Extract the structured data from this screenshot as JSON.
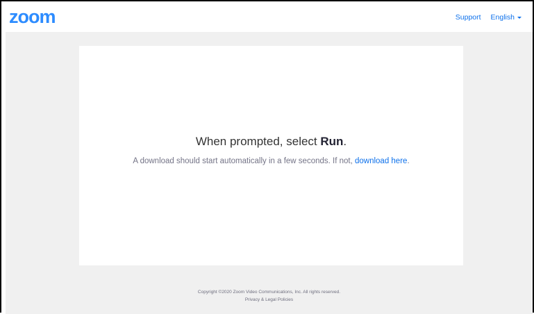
{
  "header": {
    "logo_text": "zoom",
    "support_label": "Support",
    "language_label": "English",
    "accent_color": "#2D8CFF",
    "link_color": "#0E71EB"
  },
  "main": {
    "headline_prefix": "When prompted, select ",
    "headline_bold": "Run",
    "headline_suffix": ".",
    "subline_text": "A download should start automatically in a few seconds. If not, ",
    "download_link_label": "download here",
    "subline_suffix": "."
  },
  "footer": {
    "copyright": "Copyright ©2020 Zoom Video Communications, Inc. All rights reserved.",
    "policies_link": "Privacy & Legal Policies"
  }
}
